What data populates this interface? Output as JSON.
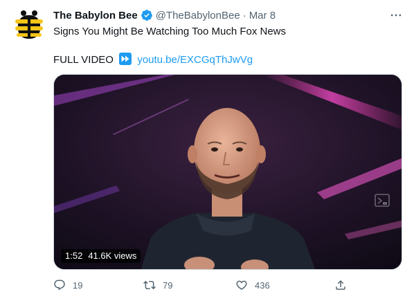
{
  "tweet": {
    "author_name": "The Babylon Bee",
    "author_handle": "@TheBabylonBee",
    "separator": "·",
    "date": "Mar 8",
    "text": "Signs You Might Be Watching Too Much Fox News",
    "video_prefix": "FULL VIDEO",
    "link_text": "youtu.be/EXCGqThJwVg"
  },
  "video": {
    "duration": "1:52",
    "views": "41.6K views"
  },
  "actions": {
    "replies": "19",
    "retweets": "79",
    "likes": "436"
  },
  "colors": {
    "accent": "#1d9bf0",
    "text_secondary": "#536471",
    "bee_yellow": "#f5c518"
  },
  "icons": [
    "babylon-bee-logo",
    "verified-badge-icon",
    "more-options-icon",
    "fast-forward-icon",
    "video-embed-icon",
    "reply-icon",
    "retweet-icon",
    "like-icon",
    "share-icon"
  ]
}
